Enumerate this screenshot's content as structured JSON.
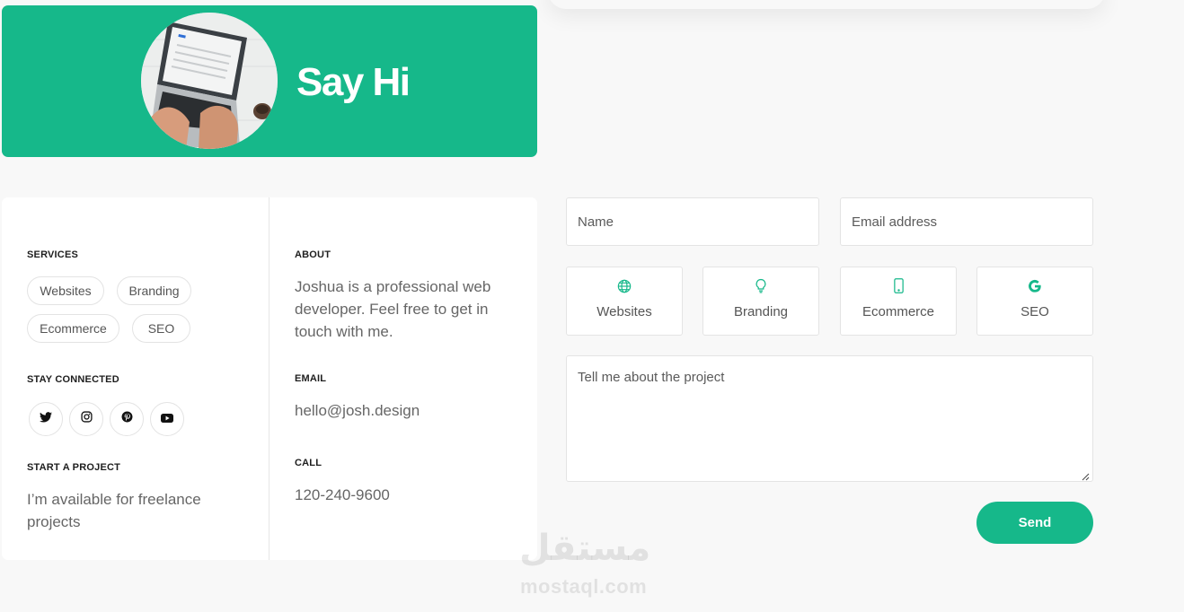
{
  "hero": {
    "title": "Say Hi"
  },
  "services": {
    "heading": "SERVICES",
    "tags": [
      "Websites",
      "Branding",
      "Ecommerce",
      "SEO"
    ]
  },
  "social": {
    "heading": "STAY CONNECTED",
    "icons": [
      "twitter-icon",
      "instagram-icon",
      "pinterest-icon",
      "youtube-icon"
    ]
  },
  "project": {
    "heading": "START A PROJECT",
    "text": "I’m available for freelance projects"
  },
  "about": {
    "heading": "ABOUT",
    "text": "Joshua is a professional web developer. Feel free to get in touch with me."
  },
  "email": {
    "heading": "EMAIL",
    "value": "hello@josh.design"
  },
  "call": {
    "heading": "CALL",
    "value": "120-240-9600"
  },
  "form": {
    "name_placeholder": "Name",
    "email_placeholder": "Email address",
    "message_placeholder": "Tell me about the project",
    "send_label": "Send",
    "services": [
      {
        "label": "Websites",
        "icon": "globe-icon"
      },
      {
        "label": "Branding",
        "icon": "lightbulb-icon"
      },
      {
        "label": "Ecommerce",
        "icon": "mobile-phone-icon"
      },
      {
        "label": "SEO",
        "icon": "google-icon"
      }
    ]
  },
  "watermark": {
    "arabic": "مستقل",
    "latin": "mostaql.com"
  },
  "colors": {
    "accent": "#16b88a",
    "background": "#f8f8f8",
    "card": "#ffffff"
  }
}
